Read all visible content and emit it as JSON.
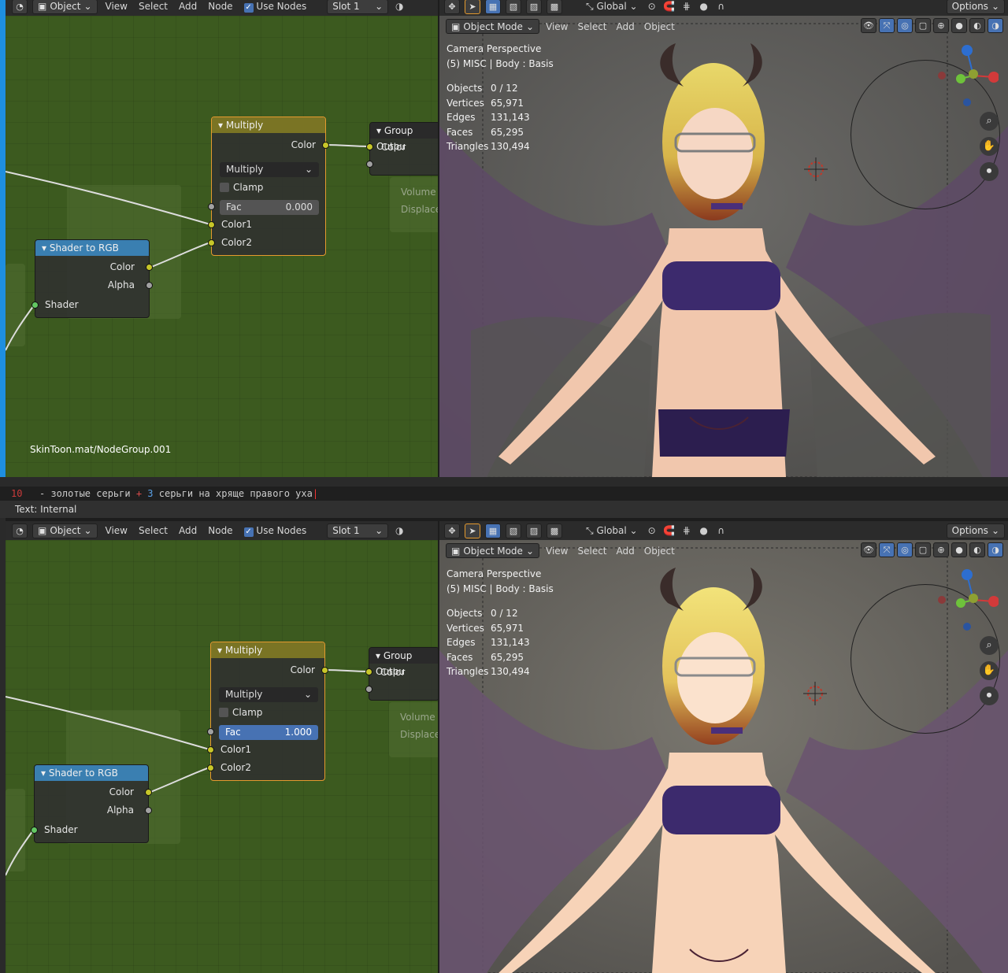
{
  "top": {
    "node_header": {
      "object_label": "Object",
      "menus": [
        "View",
        "Select",
        "Add",
        "Node"
      ],
      "use_nodes_label": "Use Nodes",
      "slot_label": "Slot 1"
    },
    "viewport_header": {
      "global_label": "Global",
      "options_label": "Options",
      "mode_label": "Object Mode",
      "menus": [
        "View",
        "Select",
        "Add",
        "Object"
      ]
    },
    "nodes": {
      "multiply": {
        "title": "Multiply",
        "color_out": "Color",
        "blend_mode": "Multiply",
        "clamp_label": "Clamp",
        "fac_label": "Fac",
        "fac_value": "0.000",
        "color1": "Color1",
        "color2": "Color2"
      },
      "group_output": {
        "title": "Group Outpu",
        "color": "Color",
        "volume": "Volume",
        "displace": "Displace"
      },
      "shader_to_rgb": {
        "title": "Shader to RGB",
        "color": "Color",
        "alpha": "Alpha",
        "shader": "Shader"
      }
    },
    "path": "SkinToon.mat/NodeGroup.001",
    "viewport": {
      "camera": "Camera Perspective",
      "context": "(5) MISC | Body : Basis",
      "stats": [
        {
          "k": "Objects",
          "v": "0 / 12"
        },
        {
          "k": "Vertices",
          "v": "65,971"
        },
        {
          "k": "Edges",
          "v": "131,143"
        },
        {
          "k": "Faces",
          "v": "65,295"
        },
        {
          "k": "Triangles",
          "v": "130,494"
        }
      ]
    }
  },
  "text_editor": {
    "line_number": "10",
    "line_text_a": "- золотые серьги ",
    "line_plus": "+",
    "line_num": " 3 ",
    "line_text_b": "серьги на хряще правого уха",
    "status": "Text: Internal"
  },
  "bottom": {
    "node_header": {
      "object_label": "Object",
      "menus": [
        "View",
        "Select",
        "Add",
        "Node"
      ],
      "use_nodes_label": "Use Nodes",
      "slot_label": "Slot 1"
    },
    "viewport_header": {
      "global_label": "Global",
      "options_label": "Options",
      "mode_label": "Object Mode",
      "menus": [
        "View",
        "Select",
        "Add",
        "Object"
      ]
    },
    "nodes": {
      "multiply": {
        "title": "Multiply",
        "color_out": "Color",
        "blend_mode": "Multiply",
        "clamp_label": "Clamp",
        "fac_label": "Fac",
        "fac_value": "1.000",
        "color1": "Color1",
        "color2": "Color2"
      },
      "group_output": {
        "title": "Group Outpu",
        "color": "Color",
        "volume": "Volume",
        "displace": "Displace"
      },
      "shader_to_rgb": {
        "title": "Shader to RGB",
        "color": "Color",
        "alpha": "Alpha",
        "shader": "Shader"
      }
    },
    "viewport": {
      "camera": "Camera Perspective",
      "context": "(5) MISC | Body : Basis",
      "stats": [
        {
          "k": "Objects",
          "v": "0 / 12"
        },
        {
          "k": "Vertices",
          "v": "65,971"
        },
        {
          "k": "Edges",
          "v": "131,143"
        },
        {
          "k": "Faces",
          "v": "65,295"
        },
        {
          "k": "Triangles",
          "v": "130,494"
        }
      ]
    }
  },
  "icons": [
    "editor-type-icon",
    "object-icon",
    "shading-icon",
    "transform-icon",
    "select-box-icon",
    "global-orientation-icon",
    "pivot-icon",
    "snap-icon",
    "proportional-icon",
    "visibility-icon",
    "gizmo-icon",
    "overlay-icon",
    "xray-icon",
    "wireframe-icon",
    "solid-icon",
    "material-icon",
    "rendered-icon",
    "zoom-icon",
    "pan-icon",
    "camera-icon",
    "axis-gizmo-icon"
  ],
  "colors": {
    "node_bg": "#3c5a1f",
    "multiply_header": "#7a7424",
    "shader_rgb_header": "#3a7fb1",
    "active_field": "#4772b3",
    "viewport_bg": "#5a5a58",
    "selected_outline": "#e59a2e"
  }
}
